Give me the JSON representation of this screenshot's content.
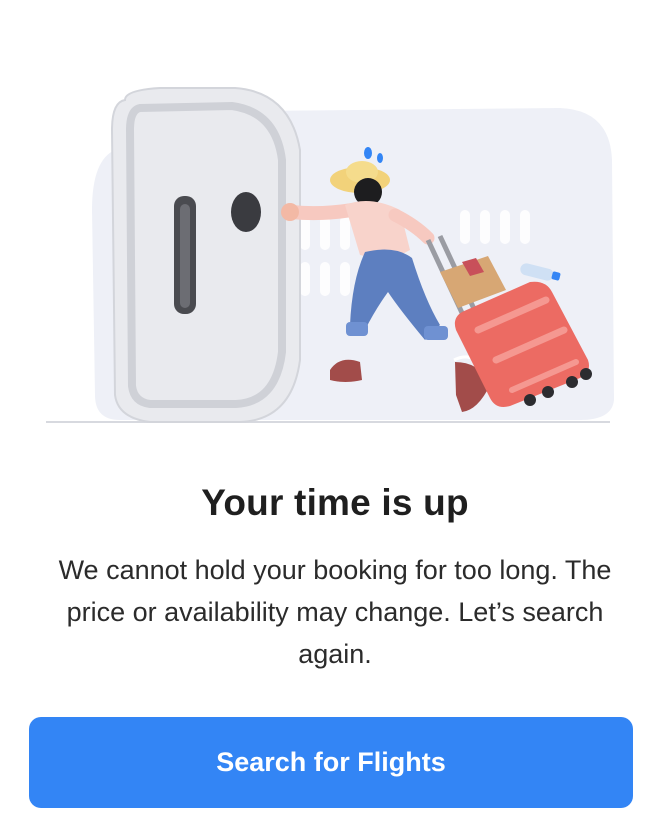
{
  "dialog": {
    "title": "Your time is up",
    "message": "We cannot hold your booking for too long. The price or availability may change. Let’s search again.",
    "primary_button": "Search for Flights"
  },
  "colors": {
    "accent": "#3385f5",
    "title_text": "#1f1f1f",
    "body_text": "#2b2b2b",
    "illustration_bg": "#eef0f7",
    "suitcase": "#ec6b63",
    "door": "#e6e7eb"
  },
  "illustration": {
    "icon": "traveler-running-to-closing-door-icon"
  }
}
